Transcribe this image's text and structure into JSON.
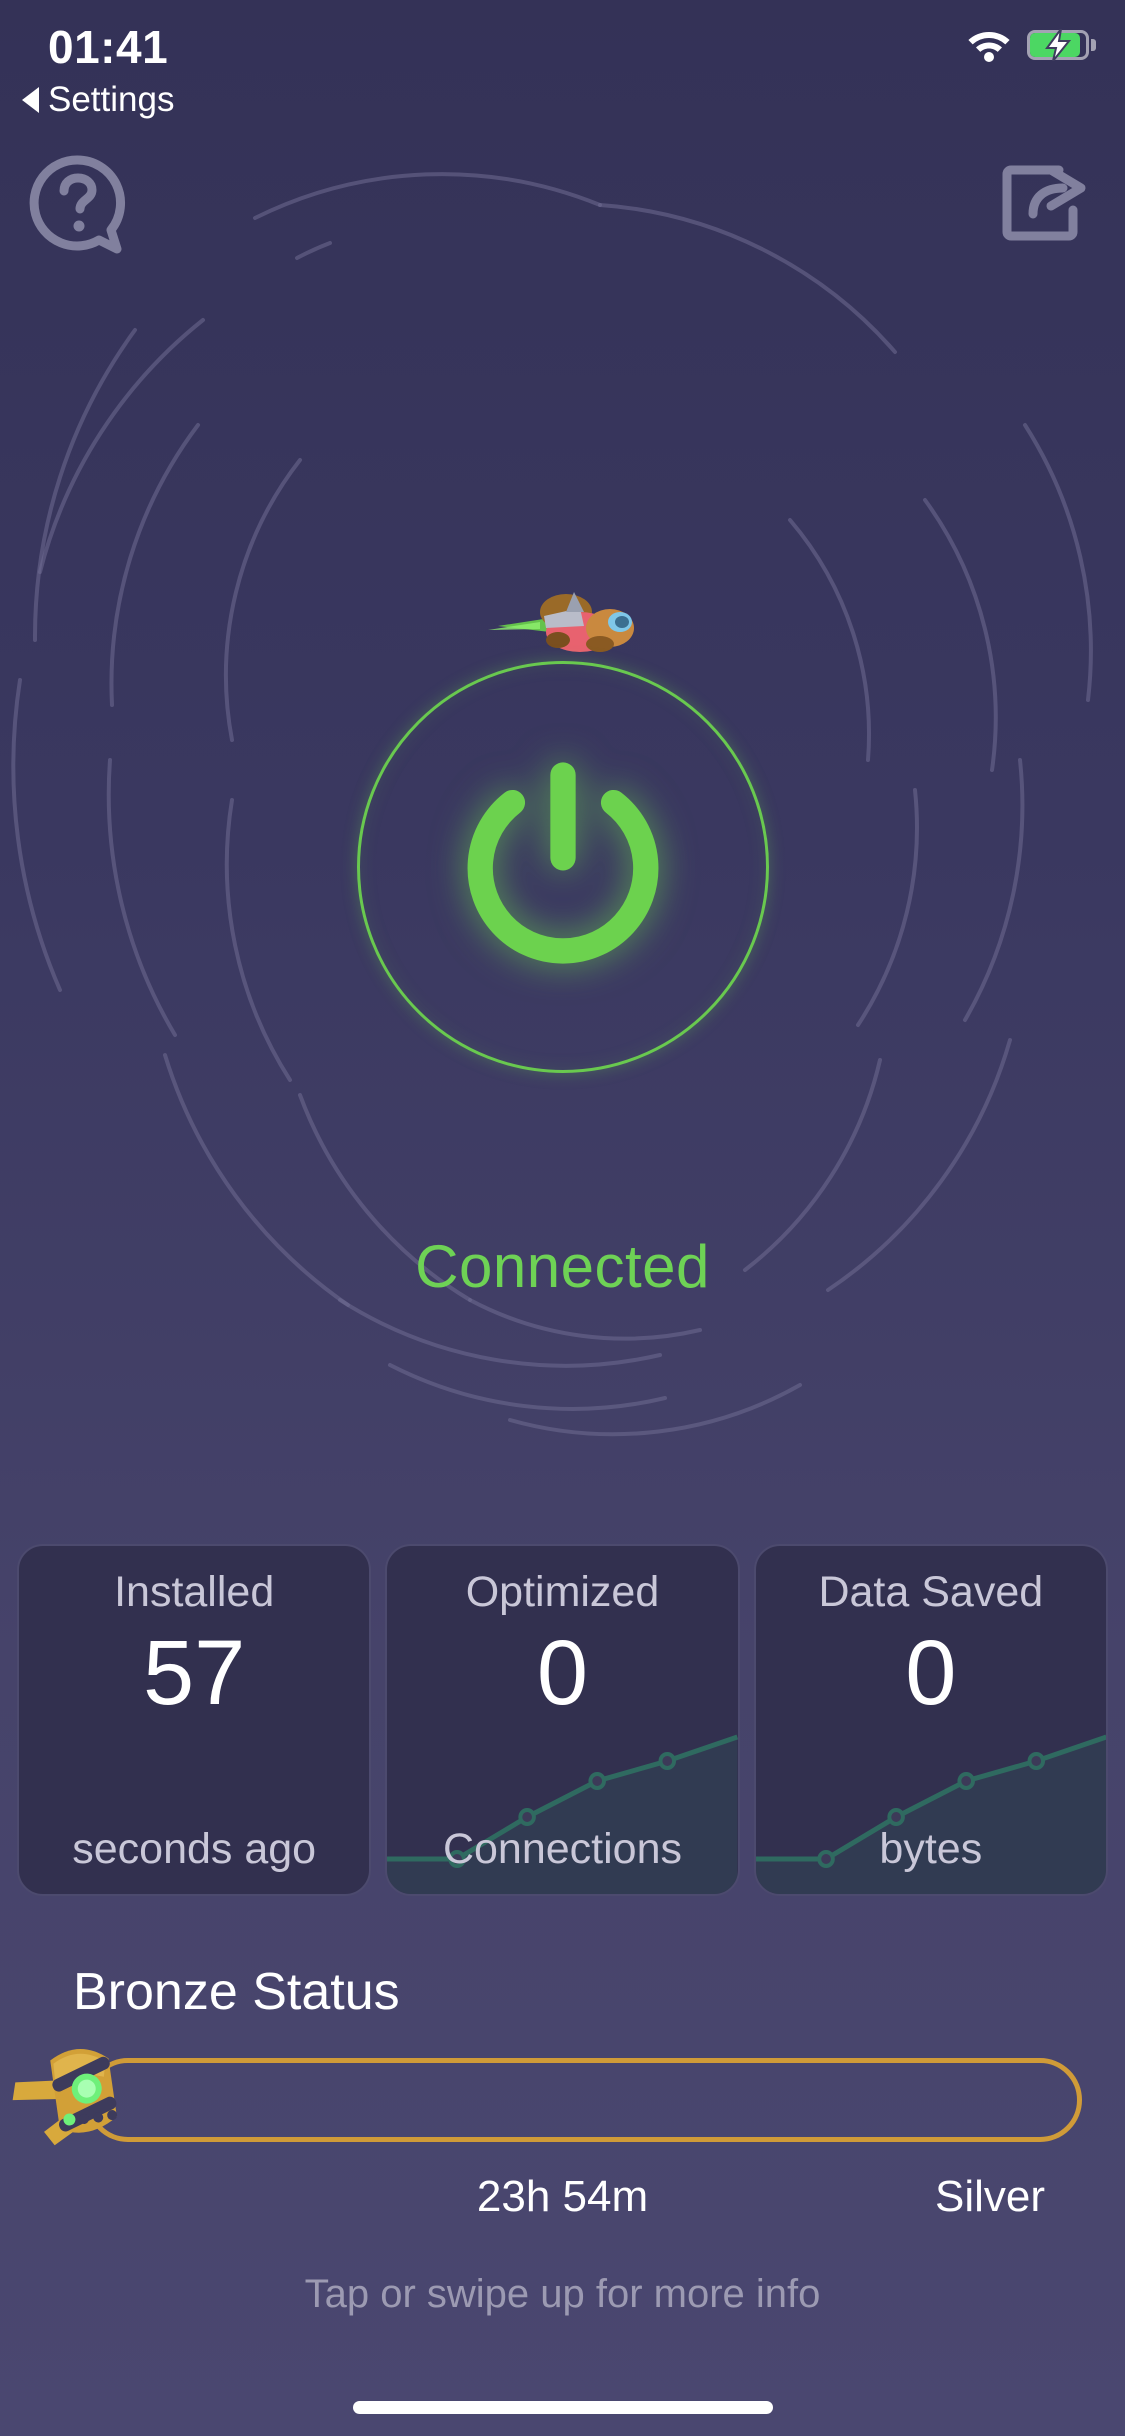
{
  "status_bar": {
    "time": "01:41",
    "back_label": "Settings",
    "back_icon": "triangle-left-icon",
    "wifi_icon": "wifi-icon",
    "battery_icon": "battery-charging-icon"
  },
  "nav": {
    "help_icon": "help-question-bubble-icon",
    "share_icon": "share-export-icon"
  },
  "hero": {
    "mascot_icon": "flying-mascot-jetpack-icon",
    "power_icon": "power-icon",
    "status_text": "Connected",
    "status_color": "#6ed255",
    "accent_color": "#69c94f",
    "background_color": "#3e3c5e"
  },
  "stats": [
    {
      "title": "Installed",
      "value": "57",
      "unit": "seconds ago",
      "has_sparkline": false
    },
    {
      "title": "Optimized",
      "value": "0",
      "unit": "Connections",
      "has_sparkline": true
    },
    {
      "title": "Data Saved",
      "value": "0",
      "unit": "bytes",
      "has_sparkline": true
    }
  ],
  "tier": {
    "title": "Bronze Status",
    "rocket_icon": "bronze-rocket-icon",
    "progress_percent": 0,
    "track_color": "#d09b38",
    "time_remaining": "23h 54m",
    "next_tier": "Silver"
  },
  "footer": {
    "hint": "Tap or swipe up for more info",
    "home_indicator": "home-indicator"
  },
  "chart_data": [
    {
      "type": "line",
      "title": "Optimized Connections",
      "x": [
        0,
        1,
        2,
        3,
        4,
        5
      ],
      "values": [
        10,
        10,
        32,
        52,
        63,
        78
      ],
      "ylabel": "Connections",
      "xlabel": "",
      "ylim": [
        0,
        100
      ],
      "grid": false,
      "legend": "none",
      "series_color": "#2f6a60"
    },
    {
      "type": "line",
      "title": "Data Saved",
      "x": [
        0,
        1,
        2,
        3,
        4,
        5
      ],
      "values": [
        10,
        10,
        32,
        52,
        63,
        78
      ],
      "ylabel": "bytes",
      "xlabel": "",
      "ylim": [
        0,
        100
      ],
      "grid": false,
      "legend": "none",
      "series_color": "#2f6a60"
    }
  ]
}
